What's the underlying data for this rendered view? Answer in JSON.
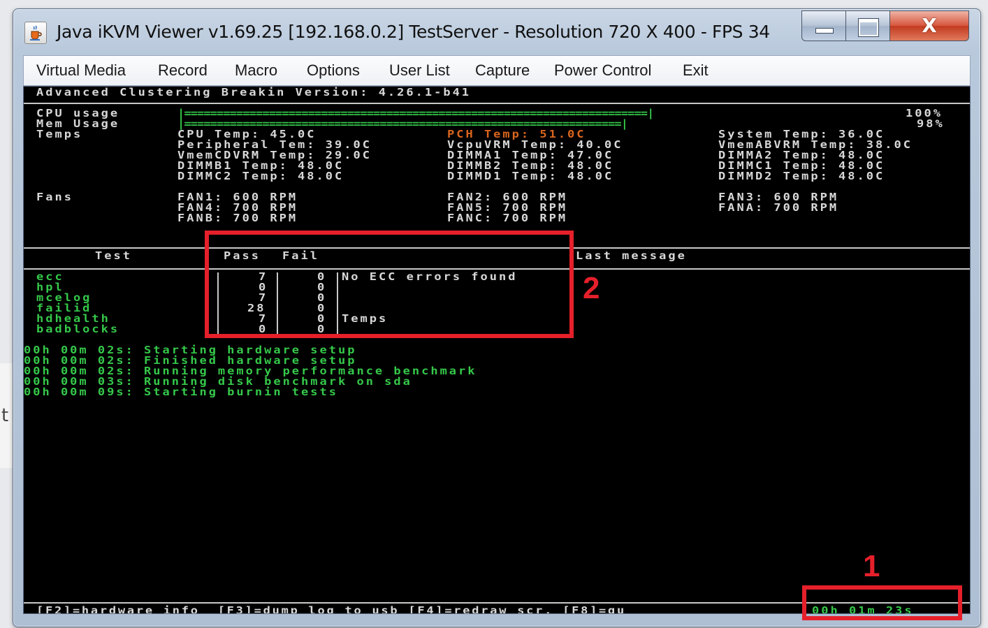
{
  "background_app": {
    "glyph": "t"
  },
  "window": {
    "title": "Java iKVM Viewer v1.69.25 [192.168.0.2] TestServer - Resolution 720 X 400 - FPS 34",
    "controls": {
      "close": "X"
    }
  },
  "menu": [
    "Virtual Media",
    "Record",
    "Macro",
    "Options",
    "User List",
    "Capture",
    "Power Control",
    "Exit"
  ],
  "console": {
    "header": "Advanced Clustering Breakin Version: 4.26.1-b41",
    "cpu_usage_label": "CPU usage",
    "mem_usage_label": "Mem Usage",
    "cpu_usage_bar": "|=======================================================================|",
    "mem_usage_bar": "|===================================================================|",
    "cpu_usage_value": "100%",
    "mem_usage_value": "98%",
    "cpu_usage_percent": 100,
    "mem_usage_percent": 98,
    "temps_label": "Temps",
    "temps": [
      [
        "CPU Temp: 45.0C",
        "PCH Temp: 51.0C",
        "System Temp: 36.0C"
      ],
      [
        "Peripheral Tem: 39.0C",
        "VcpuVRM Temp: 40.0C",
        "VmemABVRM Temp: 38.0C"
      ],
      [
        "VmemCDVRM Temp: 29.0C",
        "DIMMA1 Temp: 47.0C",
        "DIMMA2 Temp: 48.0C"
      ],
      [
        "DIMMB1 Temp: 48.0C",
        "DIMMB2 Temp: 48.0C",
        "DIMMC1 Temp: 48.0C"
      ],
      [
        "DIMMC2 Temp: 48.0C",
        "DIMMD1 Temp: 48.0C",
        "DIMMD2 Temp: 48.0C"
      ]
    ],
    "highlight_color": "#d9651e",
    "fans_label": "Fans",
    "fans": [
      [
        "FAN1: 600 RPM",
        "FAN2: 600 RPM",
        "FAN3: 600 RPM"
      ],
      [
        "FAN4: 700 RPM",
        "FAN5: 700 RPM",
        "FANA: 700 RPM"
      ],
      [
        "FANB: 700 RPM",
        "FANC: 700 RPM",
        ""
      ]
    ],
    "table_headers": {
      "test": "Test",
      "pass": "Pass",
      "fail": "Fail",
      "last_message": "Last message"
    },
    "tests": [
      {
        "name": "ecc",
        "pass": "7",
        "fail": "0",
        "message": "No ECC errors found"
      },
      {
        "name": "hpl",
        "pass": "0",
        "fail": "0",
        "message": ""
      },
      {
        "name": "mcelog",
        "pass": "7",
        "fail": "0",
        "message": ""
      },
      {
        "name": "failid",
        "pass": "28",
        "fail": "0",
        "message": ""
      },
      {
        "name": "hdhealth",
        "pass": "7",
        "fail": "0",
        "message": "Temps"
      },
      {
        "name": "badblocks",
        "pass": "0",
        "fail": "0",
        "message": ""
      }
    ],
    "log": [
      "00h 00m 02s: Starting hardware setup",
      "00h 00m 02s: Finished hardware setup",
      "00h 00m 02s: Running memory performance benchmark",
      "00h 00m 03s: Running disk benchmark on sda",
      "00h 00m 09s: Starting burnin tests"
    ],
    "footer": "[F2]=hardware info  [F3]=dump log to usb [F4]=redraw scr. [F8]=qu",
    "elapsed": "00h 01m 23s",
    "text_color": "#d8d8d8",
    "green_color": "#35c84a"
  },
  "annotations": [
    {
      "number": "1",
      "color": "#e5202b"
    },
    {
      "number": "2",
      "color": "#e5202b"
    }
  ]
}
